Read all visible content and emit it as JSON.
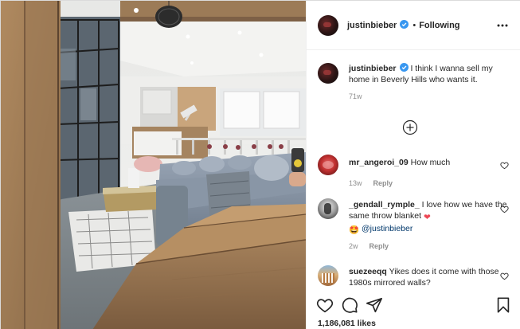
{
  "post": {
    "author": "justinbieber",
    "follow_state": "Following",
    "separator": "•",
    "caption": "I think I wanna sell my home in Beverly Hills who wants it.",
    "age": "71w",
    "likes": "1,186,081 likes"
  },
  "comments": [
    {
      "user": "mr_angeroi_09",
      "text": "How much",
      "age": "13w",
      "reply_label": "Reply"
    },
    {
      "user": "_gendall_rymple_",
      "text": "I love how we have the same throw blanket",
      "text_emoji": "❤",
      "line2_emoji": "🤩",
      "mention": "@justinbieber",
      "age": "2w",
      "reply_label": "Reply"
    },
    {
      "user": "suezeeqq",
      "text": "Yikes does it come with those 1980s mirrored walls?"
    }
  ],
  "icons": {
    "verified": "verified-badge-icon",
    "more": "more-options-icon",
    "load_more": "plus-circle-icon",
    "like": "heart-icon",
    "comment": "comment-icon",
    "share": "share-icon",
    "save": "bookmark-icon"
  },
  "colors": {
    "verified_blue": "#3897f0",
    "text": "#262626",
    "secondary": "#8e8e8e",
    "mention": "#00376b",
    "heart_red": "#ed4956"
  }
}
